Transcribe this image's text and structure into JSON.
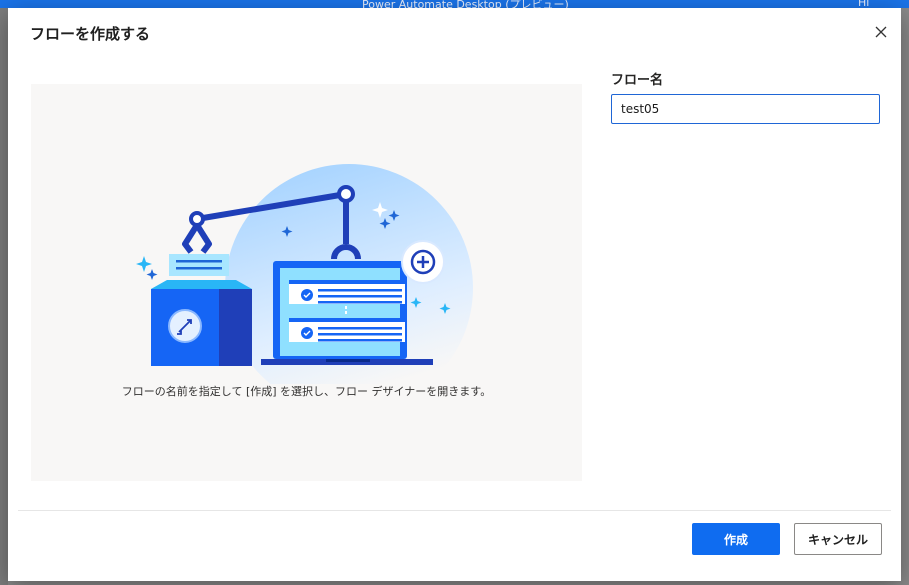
{
  "background": {
    "app_title": "Power Automate Desktop (プレビュー)",
    "user_initials": "Hi",
    "colors": {
      "topbar": "#1a73e8"
    }
  },
  "dialog": {
    "title": "フローを作成する",
    "close_icon": "close-icon",
    "illustration_caption": "フローの名前を指定して [作成] を選択し、フロー デザイナーを開きます。",
    "flow_name_label": "フロー名",
    "flow_name_value": "test05",
    "create_label": "作成",
    "cancel_label": "キャンセル",
    "colors": {
      "primary": "#0f6cf0",
      "accent_dark": "#1f3fb8",
      "accent_light": "#7fd6ff"
    }
  }
}
